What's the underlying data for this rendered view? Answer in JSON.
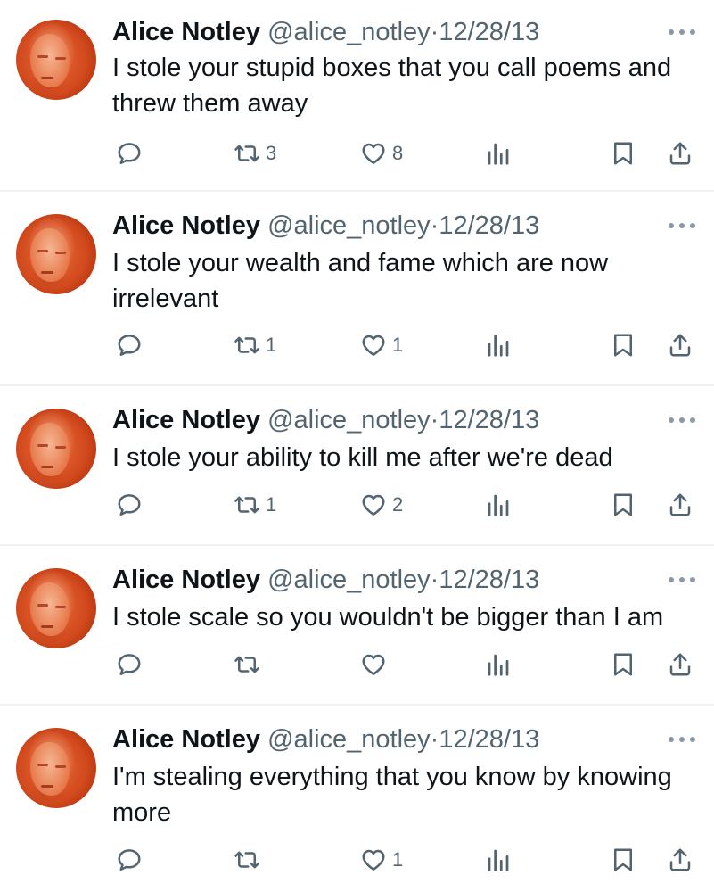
{
  "tweets": [
    {
      "name": "Alice Notley",
      "handle": "@alice_notley",
      "separator": "·",
      "date": "12/28/13",
      "text": "I stole your stupid boxes that you call poems and threw them away",
      "retweets": "3",
      "likes": "8"
    },
    {
      "name": "Alice Notley",
      "handle": "@alice_notley",
      "separator": "·",
      "date": "12/28/13",
      "text": "I stole your wealth and fame which are now irrelevant",
      "retweets": "1",
      "likes": "1"
    },
    {
      "name": "Alice Notley",
      "handle": "@alice_notley",
      "separator": "·",
      "date": "12/28/13",
      "text": "I stole your ability to kill me after we're dead",
      "retweets": "1",
      "likes": "2"
    },
    {
      "name": "Alice Notley",
      "handle": "@alice_notley",
      "separator": "·",
      "date": "12/28/13",
      "text": "I stole scale so you wouldn't be bigger than I am",
      "retweets": "",
      "likes": ""
    },
    {
      "name": "Alice Notley",
      "handle": "@alice_notley",
      "separator": "·",
      "date": "12/28/13",
      "text": "I'm stealing everything that you know by knowing more",
      "retweets": "",
      "likes": "1"
    }
  ],
  "icons": {
    "reply": "reply-icon",
    "retweet": "retweet-icon",
    "like": "heart-icon",
    "views": "views-icon",
    "bookmark": "bookmark-icon",
    "share": "share-icon",
    "more": "more-icon"
  },
  "colors": {
    "text": "#0f1419",
    "secondary": "#536471",
    "divider": "#eff3f4"
  }
}
